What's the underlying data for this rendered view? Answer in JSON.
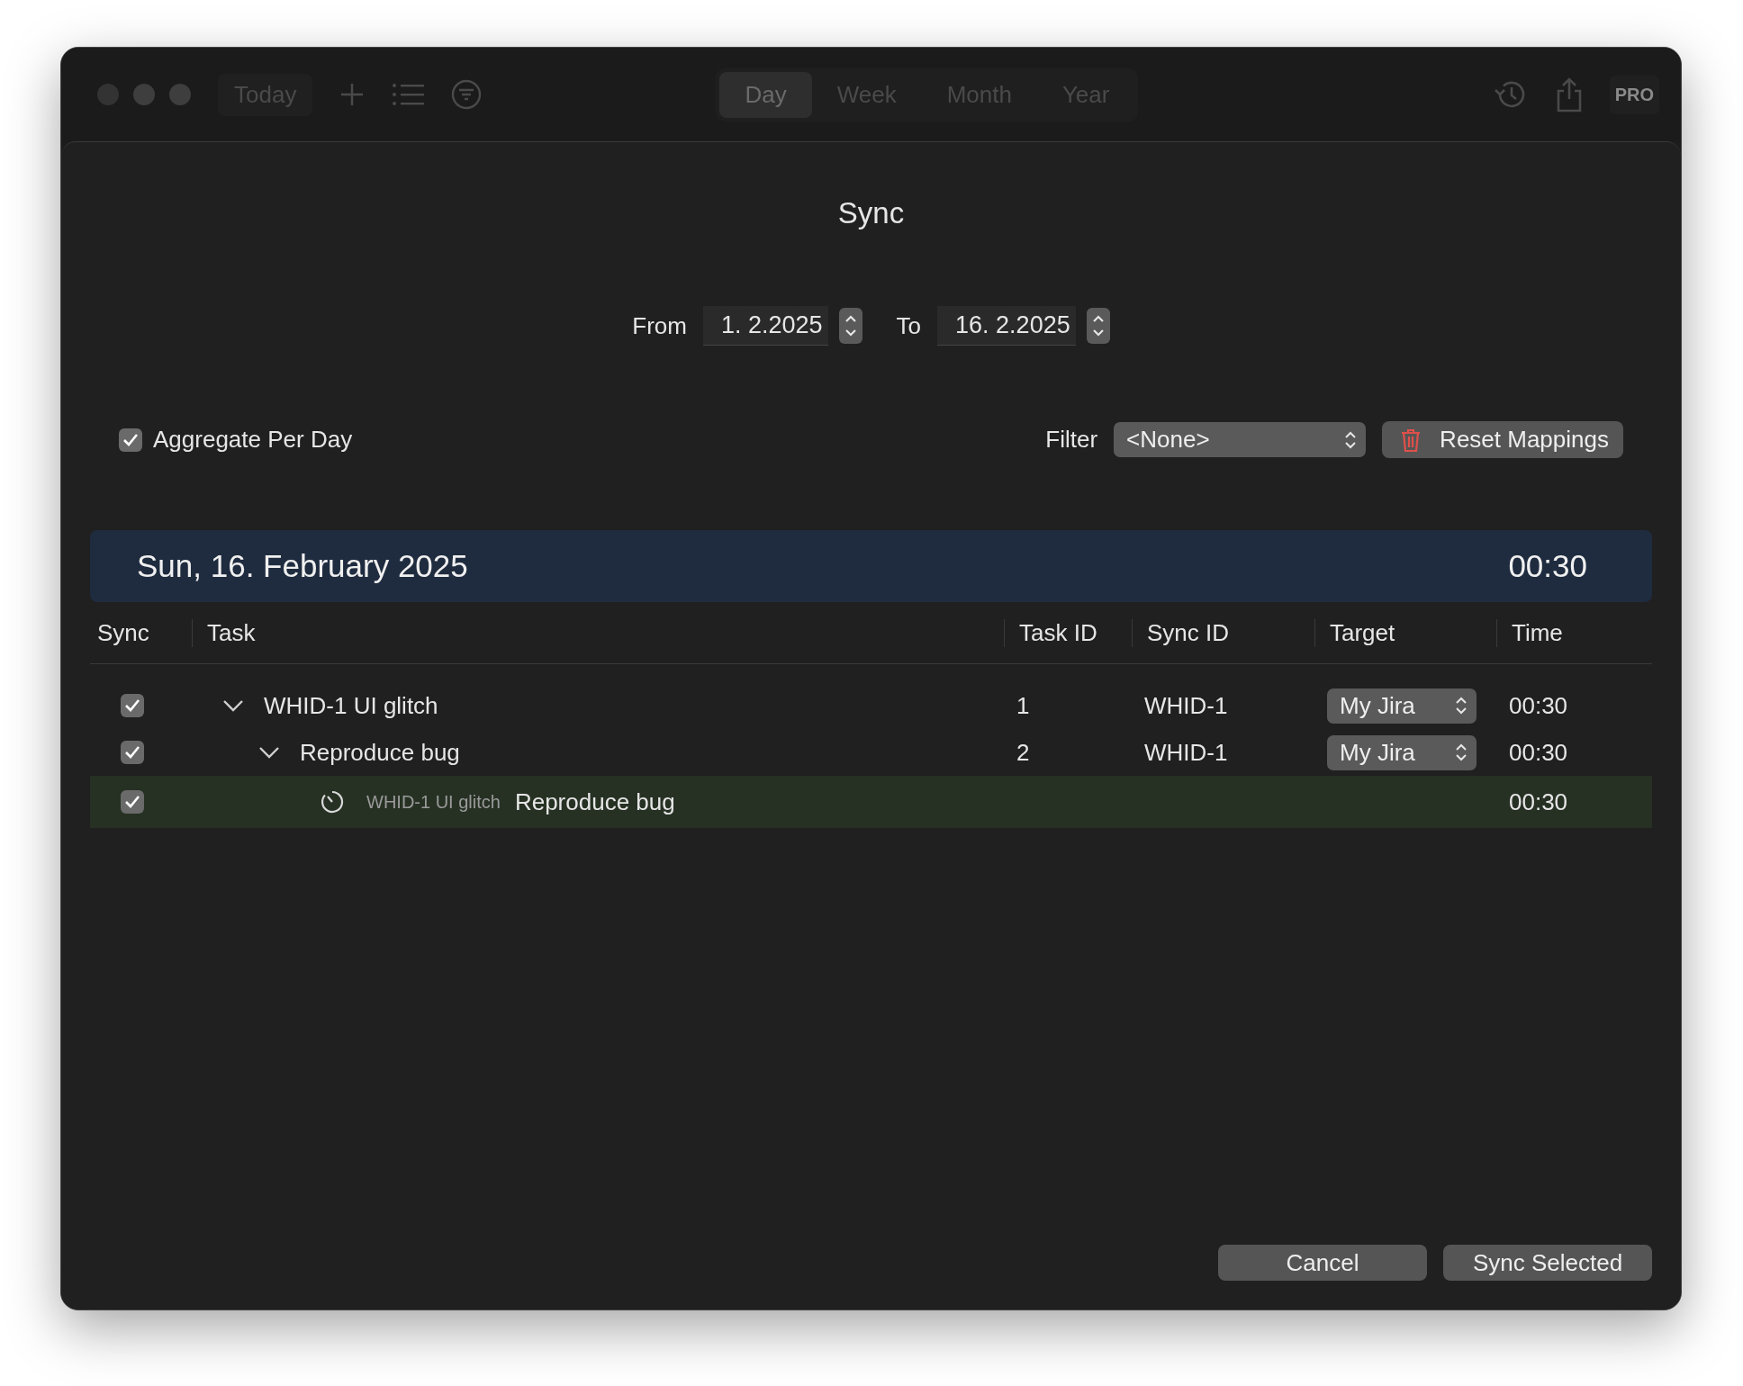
{
  "toolbar": {
    "today": "Today",
    "segments": [
      {
        "label": "Day",
        "selected": true
      },
      {
        "label": "Week",
        "selected": false
      },
      {
        "label": "Month",
        "selected": false
      },
      {
        "label": "Year",
        "selected": false
      }
    ],
    "badge": "PRO"
  },
  "dialog": {
    "title": "Sync",
    "from_label": "From",
    "from_value": "1.  2.2025",
    "to_label": "To",
    "to_value": "16.  2.2025",
    "aggregate": {
      "label": "Aggregate Per Day",
      "checked": true
    },
    "filter_label": "Filter",
    "filter_value": "<None>",
    "reset_button": "Reset Mappings",
    "day": {
      "date": "Sun, 16. February 2025",
      "total": "00:30"
    },
    "columns": [
      "Sync",
      "Task",
      "Task ID",
      "Sync ID",
      "Target",
      "Time"
    ],
    "rows": [
      {
        "kind": "task",
        "checked": true,
        "expanded": true,
        "task": "WHID-1 UI glitch",
        "task_id": "1",
        "sync_id": "WHID-1",
        "target": "My Jira",
        "time": "00:30",
        "children": [
          {
            "kind": "task",
            "checked": true,
            "expanded": true,
            "task": "Reproduce bug",
            "task_id": "2",
            "sync_id": "WHID-1",
            "target": "My Jira",
            "time": "00:30",
            "children": [
              {
                "kind": "entry",
                "checked": true,
                "parent": "WHID-1 UI glitch",
                "task": "Reproduce bug",
                "time": "00:30"
              }
            ]
          }
        ]
      }
    ],
    "buttons": [
      "Cancel",
      "Sync Selected"
    ]
  }
}
